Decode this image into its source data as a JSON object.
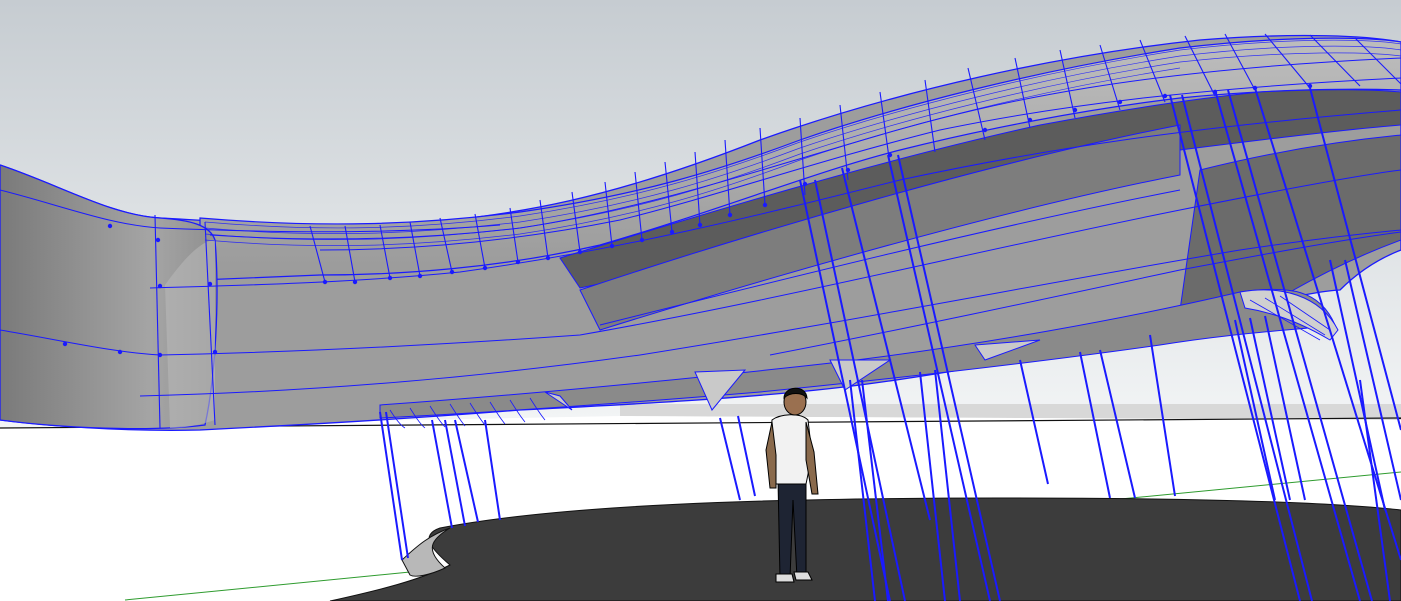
{
  "viewport": {
    "view": "perspective",
    "colors": {
      "sky_top": "#c9cfd3",
      "sky_bottom": "#f2f4f5",
      "ground": "#ffffff",
      "horizon_band": "#d9d9d9",
      "paving": "#3a3a3a",
      "roof_light": "#a9a9a9",
      "roof_mid": "#8c8c8c",
      "roof_dark": "#5e5e5e",
      "selection_edges": "#1a1aff",
      "green_axis": "#2e9b2e"
    }
  },
  "scene_objects": [
    {
      "name": "canopy-roof",
      "selected": true
    },
    {
      "name": "support-columns",
      "selected": true
    },
    {
      "name": "ground-paving",
      "selected": false
    },
    {
      "name": "scale-figure",
      "selected": false
    }
  ]
}
